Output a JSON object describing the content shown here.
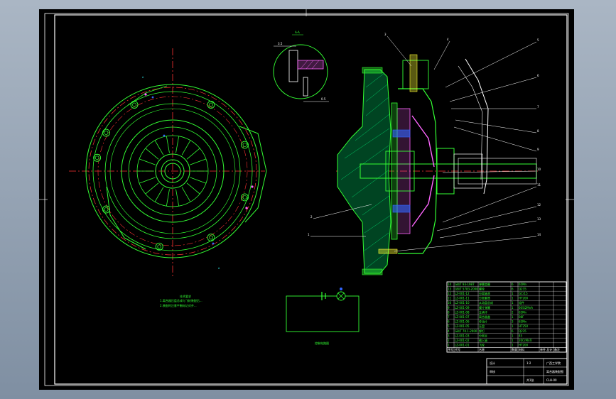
{
  "colors": {
    "background": "#000000",
    "frame": "#ffffff",
    "outline": "#33ff33",
    "centerline": "#ff3333",
    "dimension": "#33ffff",
    "section": "#ff66ff",
    "hatch": "#00cc66",
    "leader": "#ffffff",
    "blue": "#3366ff",
    "yellow": "#ffff33"
  },
  "balloons": [
    "1",
    "2",
    "3",
    "4",
    "5",
    "6",
    "7",
    "8",
    "9",
    "10",
    "11",
    "12",
    "13",
    "14"
  ],
  "detail": {
    "section_label": "A-A",
    "dim1": "3.5",
    "dim2": "0.5"
  },
  "notes": {
    "title": "技术要求",
    "line1": "1.离合器压盘总成与飞轮装配后...",
    "line2": "2.装配时注意平衡标记对齐..."
  },
  "circuit": {
    "label": "控制电路图"
  },
  "parts_table": {
    "headers": [
      "序号",
      "代号",
      "名称",
      "数量",
      "材料",
      "单件 总计",
      "备注"
    ],
    "rows": [
      [
        "14",
        "GB/T 93-1987",
        "弹簧垫圈",
        "6",
        "65Mn"
      ],
      [
        "13",
        "GB/T 5783-2000",
        "螺栓",
        "6",
        "Q235"
      ],
      [
        "12",
        "LZ-001-12",
        "分离轴承",
        "1",
        "GCr15"
      ],
      [
        "11",
        "LZ-001-11",
        "分离套筒",
        "1",
        "HT200"
      ],
      [
        "10",
        "LZ-001-10",
        "从动盘总成",
        "1",
        "组件"
      ],
      [
        "9",
        "LZ-001-09",
        "膜片弹簧",
        "1",
        "60Si2MnA"
      ],
      [
        "8",
        "LZ-001-08",
        "支承环",
        "2",
        "65Mn"
      ],
      [
        "7",
        "LZ-001-07",
        "离合器盖",
        "1",
        "08F"
      ],
      [
        "6",
        "LZ-001-06",
        "传动片",
        "3",
        "65Mn"
      ],
      [
        "5",
        "LZ-001-05",
        "压盘",
        "1",
        "HT250"
      ],
      [
        "4",
        "GB/T 70.1-2000",
        "铆钉",
        "6",
        "Q235"
      ],
      [
        "3",
        "LZ-001-03",
        "分离叉",
        "1",
        "45"
      ],
      [
        "2",
        "LZ-001-02",
        "输入轴",
        "1",
        "20CrMnTi"
      ],
      [
        "1",
        "LZ-001-01",
        "飞轮",
        "1",
        "HT200"
      ]
    ]
  },
  "title_block": {
    "company": "广西工学院",
    "drawing_name": "离合器装配图",
    "drawing_no": "CLH-00",
    "designer": "设计",
    "checker": "审核",
    "scale": "1:2",
    "sheet": "共1张"
  }
}
